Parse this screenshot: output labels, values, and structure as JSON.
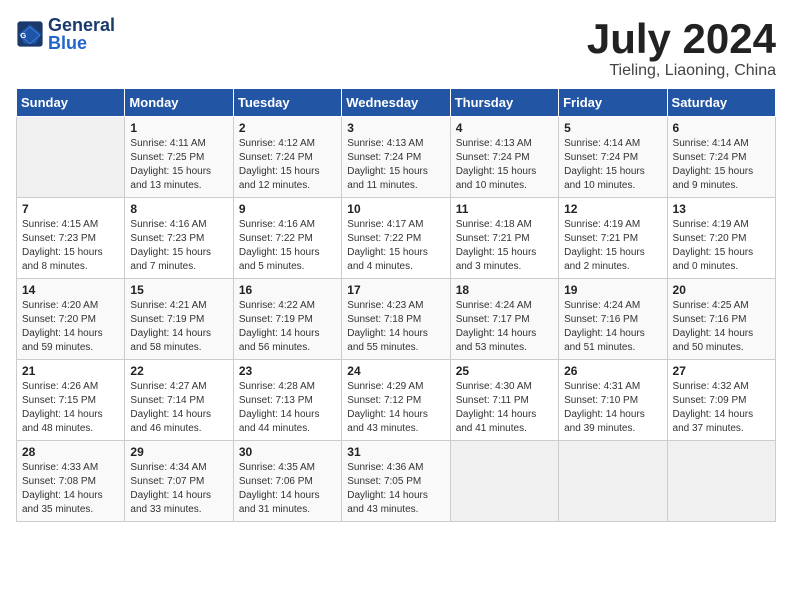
{
  "header": {
    "logo_general": "General",
    "logo_blue": "Blue",
    "month": "July 2024",
    "location": "Tieling, Liaoning, China"
  },
  "days_of_week": [
    "Sunday",
    "Monday",
    "Tuesday",
    "Wednesday",
    "Thursday",
    "Friday",
    "Saturday"
  ],
  "weeks": [
    [
      {
        "day": "",
        "empty": true
      },
      {
        "day": "1",
        "sunrise": "4:11 AM",
        "sunset": "7:25 PM",
        "daylight": "15 hours and 13 minutes."
      },
      {
        "day": "2",
        "sunrise": "4:12 AM",
        "sunset": "7:24 PM",
        "daylight": "15 hours and 12 minutes."
      },
      {
        "day": "3",
        "sunrise": "4:13 AM",
        "sunset": "7:24 PM",
        "daylight": "15 hours and 11 minutes."
      },
      {
        "day": "4",
        "sunrise": "4:13 AM",
        "sunset": "7:24 PM",
        "daylight": "15 hours and 10 minutes."
      },
      {
        "day": "5",
        "sunrise": "4:14 AM",
        "sunset": "7:24 PM",
        "daylight": "15 hours and 10 minutes."
      },
      {
        "day": "6",
        "sunrise": "4:14 AM",
        "sunset": "7:24 PM",
        "daylight": "15 hours and 9 minutes."
      }
    ],
    [
      {
        "day": "7",
        "sunrise": "4:15 AM",
        "sunset": "7:23 PM",
        "daylight": "15 hours and 8 minutes."
      },
      {
        "day": "8",
        "sunrise": "4:16 AM",
        "sunset": "7:23 PM",
        "daylight": "15 hours and 7 minutes."
      },
      {
        "day": "9",
        "sunrise": "4:16 AM",
        "sunset": "7:22 PM",
        "daylight": "15 hours and 5 minutes."
      },
      {
        "day": "10",
        "sunrise": "4:17 AM",
        "sunset": "7:22 PM",
        "daylight": "15 hours and 4 minutes."
      },
      {
        "day": "11",
        "sunrise": "4:18 AM",
        "sunset": "7:21 PM",
        "daylight": "15 hours and 3 minutes."
      },
      {
        "day": "12",
        "sunrise": "4:19 AM",
        "sunset": "7:21 PM",
        "daylight": "15 hours and 2 minutes."
      },
      {
        "day": "13",
        "sunrise": "4:19 AM",
        "sunset": "7:20 PM",
        "daylight": "15 hours and 0 minutes."
      }
    ],
    [
      {
        "day": "14",
        "sunrise": "4:20 AM",
        "sunset": "7:20 PM",
        "daylight": "14 hours and 59 minutes."
      },
      {
        "day": "15",
        "sunrise": "4:21 AM",
        "sunset": "7:19 PM",
        "daylight": "14 hours and 58 minutes."
      },
      {
        "day": "16",
        "sunrise": "4:22 AM",
        "sunset": "7:19 PM",
        "daylight": "14 hours and 56 minutes."
      },
      {
        "day": "17",
        "sunrise": "4:23 AM",
        "sunset": "7:18 PM",
        "daylight": "14 hours and 55 minutes."
      },
      {
        "day": "18",
        "sunrise": "4:24 AM",
        "sunset": "7:17 PM",
        "daylight": "14 hours and 53 minutes."
      },
      {
        "day": "19",
        "sunrise": "4:24 AM",
        "sunset": "7:16 PM",
        "daylight": "14 hours and 51 minutes."
      },
      {
        "day": "20",
        "sunrise": "4:25 AM",
        "sunset": "7:16 PM",
        "daylight": "14 hours and 50 minutes."
      }
    ],
    [
      {
        "day": "21",
        "sunrise": "4:26 AM",
        "sunset": "7:15 PM",
        "daylight": "14 hours and 48 minutes."
      },
      {
        "day": "22",
        "sunrise": "4:27 AM",
        "sunset": "7:14 PM",
        "daylight": "14 hours and 46 minutes."
      },
      {
        "day": "23",
        "sunrise": "4:28 AM",
        "sunset": "7:13 PM",
        "daylight": "14 hours and 44 minutes."
      },
      {
        "day": "24",
        "sunrise": "4:29 AM",
        "sunset": "7:12 PM",
        "daylight": "14 hours and 43 minutes."
      },
      {
        "day": "25",
        "sunrise": "4:30 AM",
        "sunset": "7:11 PM",
        "daylight": "14 hours and 41 minutes."
      },
      {
        "day": "26",
        "sunrise": "4:31 AM",
        "sunset": "7:10 PM",
        "daylight": "14 hours and 39 minutes."
      },
      {
        "day": "27",
        "sunrise": "4:32 AM",
        "sunset": "7:09 PM",
        "daylight": "14 hours and 37 minutes."
      }
    ],
    [
      {
        "day": "28",
        "sunrise": "4:33 AM",
        "sunset": "7:08 PM",
        "daylight": "14 hours and 35 minutes."
      },
      {
        "day": "29",
        "sunrise": "4:34 AM",
        "sunset": "7:07 PM",
        "daylight": "14 hours and 33 minutes."
      },
      {
        "day": "30",
        "sunrise": "4:35 AM",
        "sunset": "7:06 PM",
        "daylight": "14 hours and 31 minutes."
      },
      {
        "day": "31",
        "sunrise": "4:36 AM",
        "sunset": "7:05 PM",
        "daylight": "14 hours and 43 minutes."
      },
      {
        "day": "",
        "empty": true
      },
      {
        "day": "",
        "empty": true
      },
      {
        "day": "",
        "empty": true
      }
    ]
  ]
}
